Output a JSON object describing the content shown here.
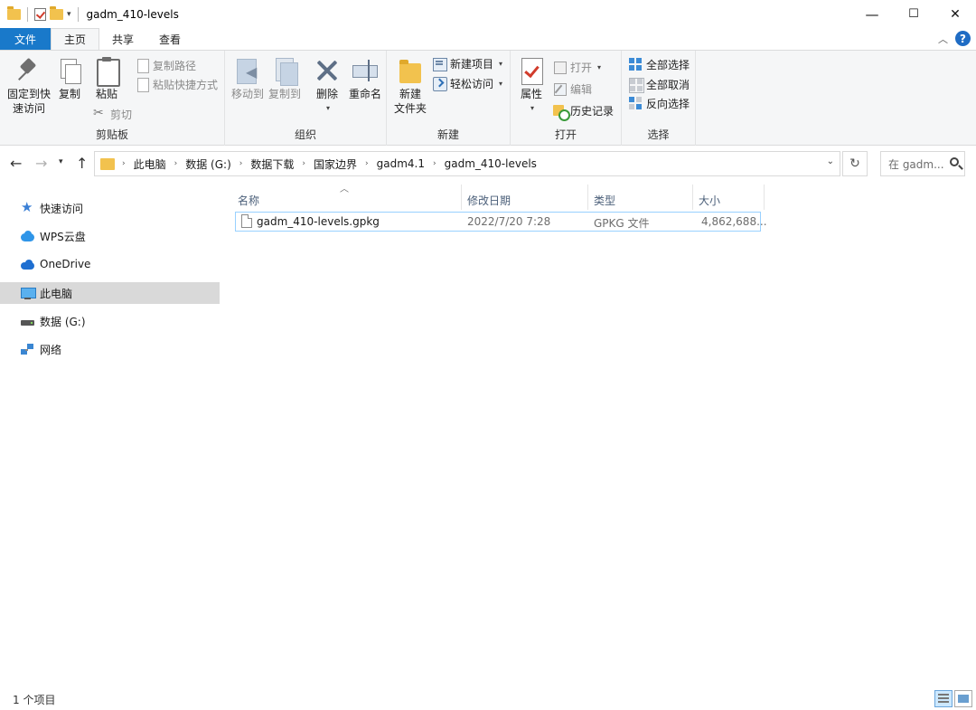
{
  "window": {
    "title": "gadm_410-levels",
    "minimize": "—",
    "maximize": "☐",
    "close": "✕"
  },
  "tabs": {
    "file": "文件",
    "home": "主页",
    "share": "共享",
    "view": "查看",
    "help": "?"
  },
  "ribbon": {
    "clipboard": {
      "label": "剪贴板",
      "pin_line1": "固定到快",
      "pin_line2": "速访问",
      "copy": "复制",
      "paste": "粘贴",
      "copy_path": "复制路径",
      "paste_shortcut": "粘贴快捷方式",
      "cut": "剪切"
    },
    "organize": {
      "label": "组织",
      "move_to": "移动到",
      "copy_to": "复制到",
      "delete": "删除",
      "rename": "重命名"
    },
    "new": {
      "label": "新建",
      "new_folder_line1": "新建",
      "new_folder_line2": "文件夹",
      "new_item": "新建项目",
      "easy_access": "轻松访问"
    },
    "open": {
      "label": "打开",
      "properties": "属性",
      "open": "打开",
      "edit": "编辑",
      "history": "历史记录"
    },
    "select": {
      "label": "选择",
      "select_all": "全部选择",
      "select_none": "全部取消",
      "invert": "反向选择"
    }
  },
  "address": {
    "crumbs": [
      "此电脑",
      "数据 (G:)",
      "数据下载",
      "国家边界",
      "gadm4.1",
      "gadm_410-levels"
    ],
    "search_placeholder": "在 gadm..."
  },
  "nav": {
    "items": [
      {
        "label": "快速访问",
        "icon": "star-icon"
      },
      {
        "label": "WPS云盘",
        "icon": "cloud-icon"
      },
      {
        "label": "OneDrive",
        "icon": "onedrive-icon"
      },
      {
        "label": "此电脑",
        "icon": "computer-icon"
      },
      {
        "label": "数据 (G:)",
        "icon": "drive-icon"
      },
      {
        "label": "网络",
        "icon": "network-icon"
      }
    ]
  },
  "files": {
    "columns": {
      "name": "名称",
      "modified": "修改日期",
      "type": "类型",
      "size": "大小"
    },
    "rows": [
      {
        "name": "gadm_410-levels.gpkg",
        "modified": "2022/7/20 7:28",
        "type": "GPKG 文件",
        "size": "4,862,688..."
      }
    ]
  },
  "status": {
    "count": "1 个项目"
  },
  "colors": {
    "file_tab": "#1979ca",
    "selection": "#cce8ff",
    "folder": "#f2c24e"
  }
}
